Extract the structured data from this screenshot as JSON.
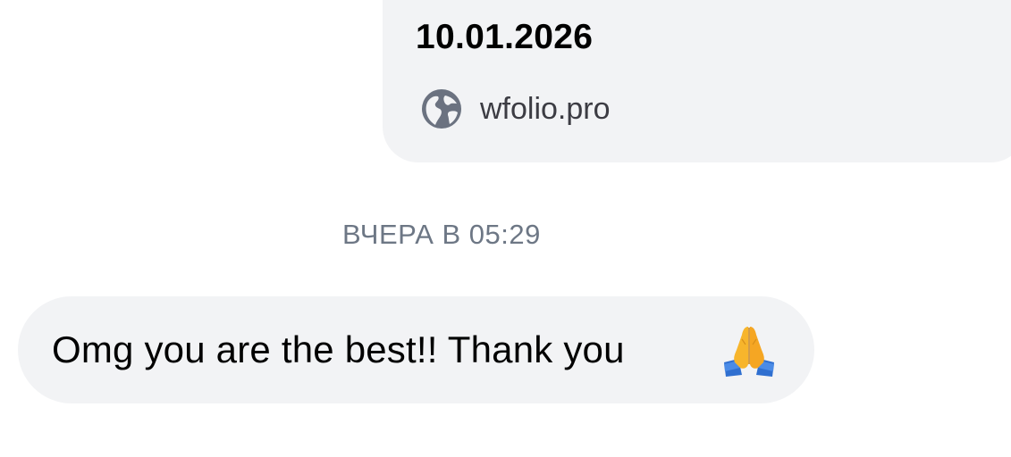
{
  "link_preview": {
    "date": "10.01.2026",
    "domain": "wfolio.pro",
    "icon": "globe-icon"
  },
  "timestamp": "ВЧЕРА В 05:29",
  "message": {
    "text": "Omg you are the best!! Thank you",
    "emoji": "folded-hands-emoji"
  },
  "colors": {
    "bubble_bg": "#f2f3f5",
    "timestamp": "#6d7785",
    "text": "#000000",
    "icon": "#6b7280"
  }
}
